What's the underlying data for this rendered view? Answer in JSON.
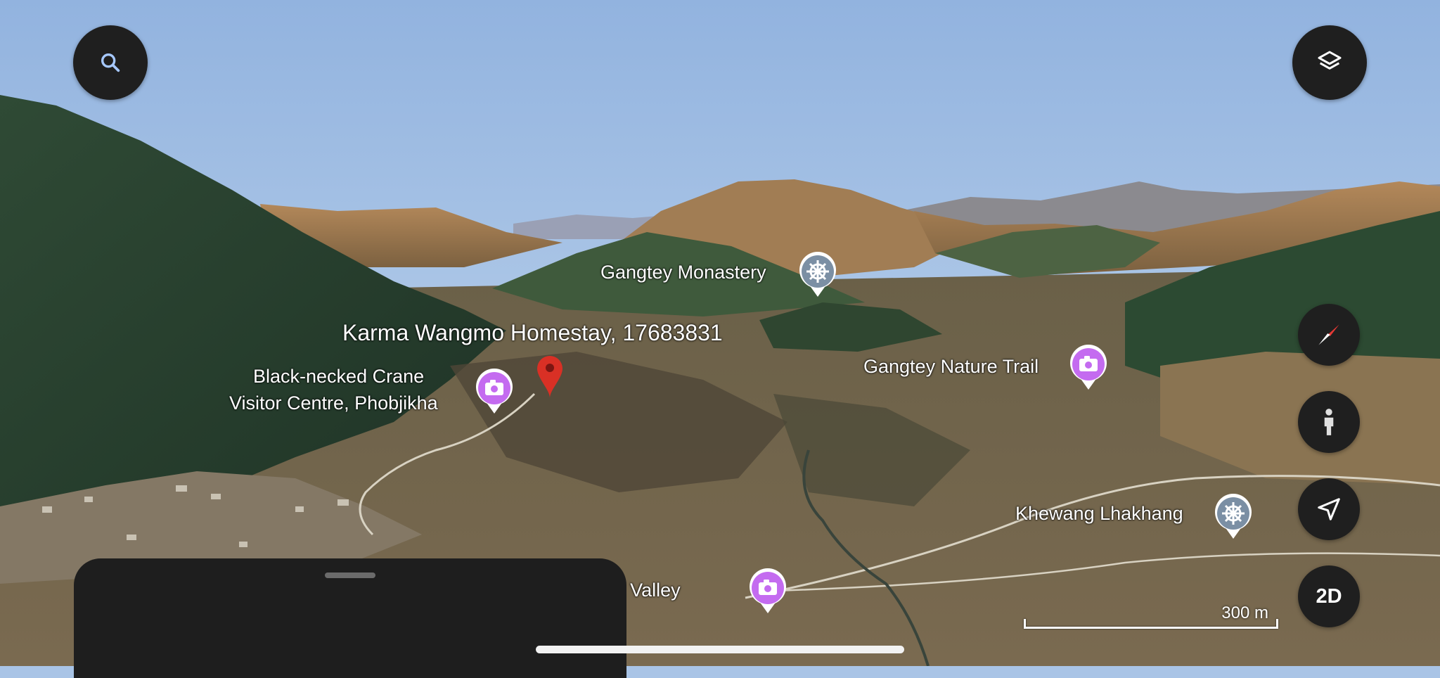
{
  "map": {
    "place_labels": {
      "gangtey_monastery": "Gangtey Monastery",
      "karma_homestay": "Karma Wangmo Homestay, 17683831",
      "crane_centre_line1": "Black-necked Crane",
      "crane_centre_line2": "Visitor Centre, Phobjikha",
      "nature_trail": "Gangtey Nature Trail",
      "khewang": "Khewang Lhakhang",
      "phobjikha_valley": "Phobjikha Valley"
    },
    "scale_bar": "300 m"
  },
  "controls": {
    "search_icon": "search-icon",
    "layers_icon": "layers-icon",
    "compass_icon": "compass-icon",
    "street_view_icon": "pegman-icon",
    "location_icon": "navigation-arrow-icon",
    "view_mode_label": "2D"
  },
  "colors": {
    "fab_background": "#1f1f1f",
    "poi_photo": "#c46bf0",
    "poi_temple": "#7b8fa4",
    "red_pin": "#d93025",
    "sky": "#a9c4e6"
  }
}
